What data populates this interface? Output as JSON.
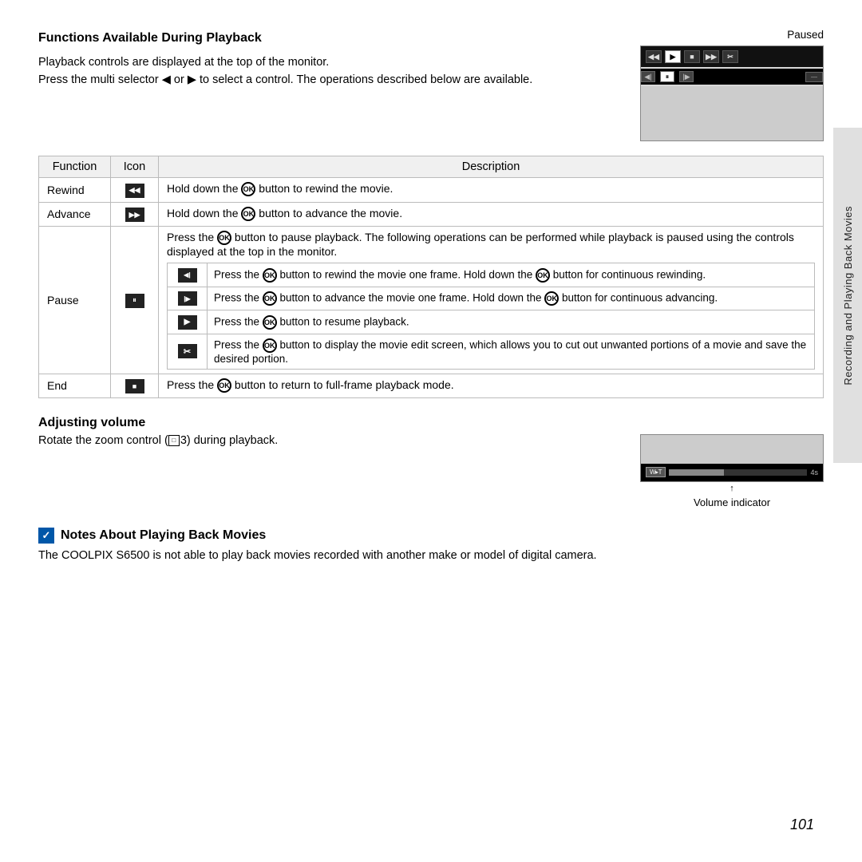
{
  "page": {
    "number": "101",
    "side_tab": "Recording and Playing Back Movies"
  },
  "section1": {
    "title": "Functions Available During Playback",
    "intro": [
      "Playback controls are displayed at the top of the monitor.",
      "Press the multi selector ◀ or ▶ to select a control. The operations described below are available."
    ],
    "paused_label": "Paused"
  },
  "table": {
    "headers": [
      "Function",
      "Icon",
      "Description"
    ],
    "rows": [
      {
        "function": "Rewind",
        "icon": "◀◀",
        "description": "Hold down the ⓄK button to rewind the movie."
      },
      {
        "function": "Advance",
        "icon": "▶▶",
        "description": "Hold down the ⓄK button to advance the movie."
      },
      {
        "function": "Pause",
        "icon": "⏸",
        "main_desc": "Press the ⓄK button to pause playback. The following operations can be performed while playback is paused using the controls displayed at the top in the monitor.",
        "sub_rows": [
          {
            "icon": "◀|",
            "desc": "Press the ⓄK button to rewind the movie one frame. Hold down the ⓄK button for continuous rewinding."
          },
          {
            "icon": "▶|",
            "desc": "Press the ⓄK button to advance the movie one frame. Hold down the ⓄK button for continuous advancing."
          },
          {
            "icon": "▶",
            "desc": "Press the ⓄK button to resume playback."
          },
          {
            "icon": "✂",
            "desc": "Press the ⓄK button to display the movie edit screen, which allows you to cut out unwanted portions of a movie and save the desired portion."
          }
        ]
      },
      {
        "function": "End",
        "icon": "■",
        "description": "Press the ⓄK button to return to full-frame playback mode."
      }
    ]
  },
  "section2": {
    "title": "Adjusting volume",
    "text": "Rotate the zoom control (□□3) during playback.",
    "volume_label": "Volume indicator"
  },
  "notes": {
    "title": "Notes About Playing Back Movies",
    "text": "The COOLPIX S6500 is not able to play back movies recorded with another make or model of digital camera."
  }
}
